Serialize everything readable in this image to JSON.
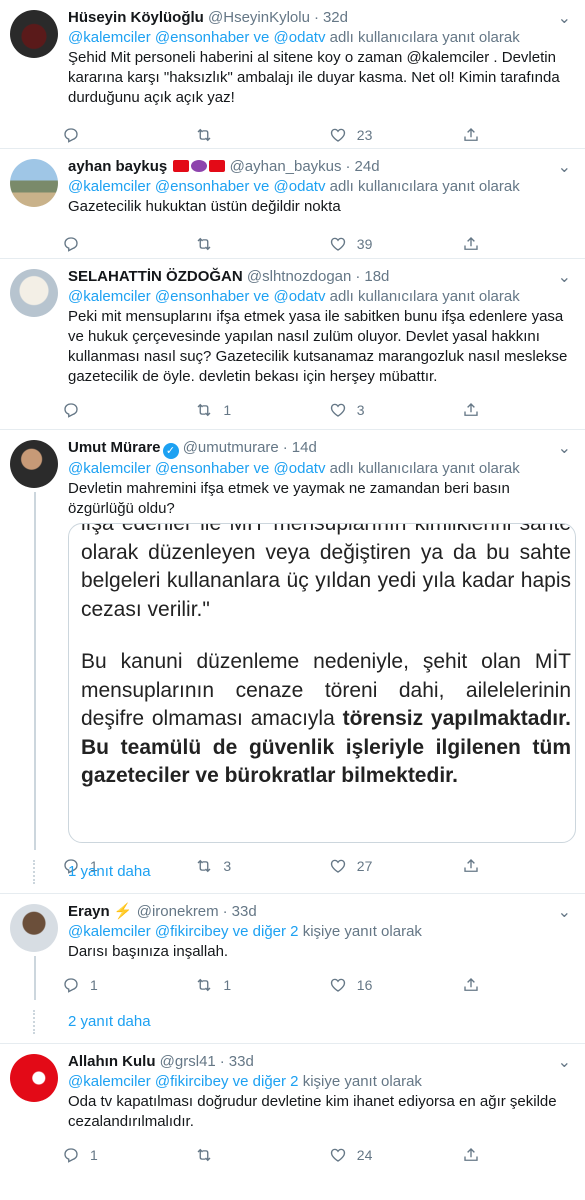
{
  "tweets": [
    {
      "name": "Hüseyin Köylüoğlu",
      "handle": "@HseyinKylolu",
      "time": "32d",
      "reply_prefix": "@kalemciler @ensonhaber ve @odatv",
      "reply_suffix": " adlı kullanıcılara yanıt olarak",
      "text": "Şehid Mit personeli haberini al sitene koy o zaman @kalemciler  . Devletin kararına karşı \"haksızlık\" ambalajı ile duyar kasma. Net ol! Kimin tarafında durduğunu açık açık yaz!",
      "replies": "",
      "retweets": "",
      "likes": "23"
    },
    {
      "name": "ayhan baykuş",
      "handle": "@ayhan_baykus",
      "time": "24d",
      "reply_prefix": "@kalemciler @ensonhaber ve @odatv",
      "reply_suffix": " adlı kullanıcılara yanıt olarak",
      "text": "Gazetecilik hukuktan üstün değildir nokta",
      "replies": "",
      "retweets": "",
      "likes": "39"
    },
    {
      "name": "SELAHATTİN ÖZDOĞAN",
      "handle": "@slhtnozdogan",
      "time": "18d",
      "reply_prefix": "@kalemciler @ensonhaber ve @odatv",
      "reply_suffix": " adlı kullanıcılara yanıt olarak",
      "text": "Peki mit mensuplarını ifşa etmek yasa ile sabitken bunu ifşa edenlere yasa ve hukuk çerçevesinde yapılan nasıl zulüm oluyor. Devlet yasal hakkını kullanması nasıl suç? Gazetecilik kutsanamaz marangozluk nasıl meslekse gazetecilik de öyle. devletin bekası için herşey mübattır.",
      "replies": "",
      "retweets": "1",
      "likes": "3"
    },
    {
      "name": "Umut Mürare",
      "handle": "@umutmurare",
      "time": "14d",
      "reply_prefix": "@kalemciler @ensonhaber ve @odatv",
      "reply_suffix": " adlı kullanıcılara yanıt olarak",
      "text": "Devletin mahremini ifşa etmek ve yaymak ne zamandan beri basın özgürlüğü oldu?",
      "media_p1": "ifşa edenler ile MİT mensuplarının kimliklerini sahte olarak düzenleyen veya değiştiren ya da bu sahte belgeleri kullananlara üç yıldan yedi yıla kadar hapis cezası verilir.\"",
      "media_p2_normal": "Bu kanuni düzenleme nedeniyle, şehit olan MİT mensuplarının cenaze töreni dahi, ailelelerinin deşifre olmaması amacıyla ",
      "media_p2_bold": "törensiz yapılmaktadır. Bu teamülü de güvenlik işleriyle ilgilenen tüm gazeteciler ve bürokratlar bilmektedir.",
      "replies": "1",
      "retweets": "3",
      "likes": "27"
    },
    {
      "name": "Erayn",
      "handle": "@ironekrem",
      "time": "33d",
      "reply_prefix": "@kalemciler @fikircibey ve diğer 2",
      "reply_suffix": " kişiye yanıt olarak",
      "text": "Darısı başınıza inşallah.",
      "replies": "1",
      "retweets": "1",
      "likes": "16"
    },
    {
      "name": "Allahın Kulu",
      "handle": "@grsl41",
      "time": "33d",
      "reply_prefix": "@kalemciler @fikircibey ve diğer 2",
      "reply_suffix": " kişiye yanıt olarak",
      "text": "Oda tv kapatılması doğrudur devletine kim ihanet ediyorsa en ağır şekilde cezalandırılmalıdır.",
      "replies": "1",
      "retweets": "",
      "likes": "24"
    }
  ],
  "show_more_1": "1 yanıt daha",
  "show_more_2": "2 yanıt daha",
  "dot": "·",
  "more_glyph": "⌄",
  "icons": [
    "reply-icon",
    "retweet-icon",
    "like-icon",
    "share-icon"
  ]
}
